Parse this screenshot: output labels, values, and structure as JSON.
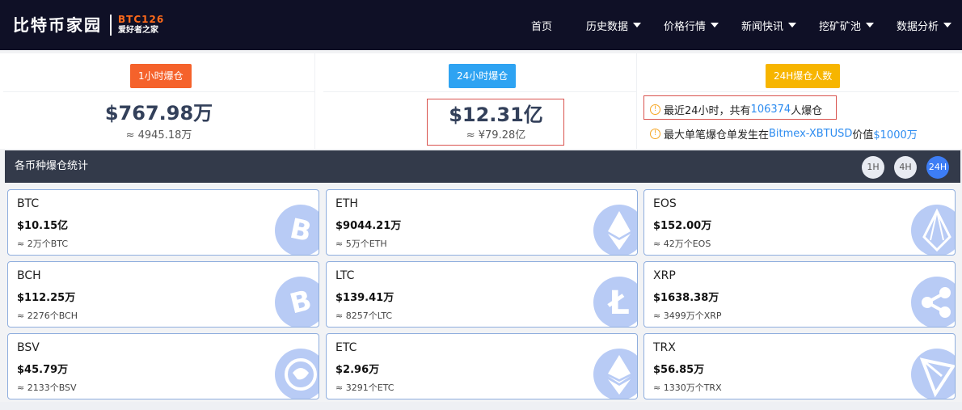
{
  "nav": {
    "logo_cn": "比特币家园",
    "logo_en": "BTC126",
    "logo_sub": "爱好者之家",
    "items": [
      {
        "label": "首页",
        "dropdown": false
      },
      {
        "label": "历史数据",
        "dropdown": true
      },
      {
        "label": "价格行情",
        "dropdown": true
      },
      {
        "label": "新闻快讯",
        "dropdown": true
      },
      {
        "label": "挖矿矿池",
        "dropdown": true
      },
      {
        "label": "数据分析",
        "dropdown": true
      }
    ]
  },
  "stats": {
    "hour1": {
      "tag": "1小时爆仓",
      "tag_color": "#f5622b",
      "value": "$767.98万",
      "approx": "≈ 4945.18万"
    },
    "hour24": {
      "tag": "24小时爆仓",
      "tag_color": "#2ea3f2",
      "value": "$12.31亿",
      "approx": "≈ ¥79.28亿"
    },
    "people": {
      "tag": "24H爆仓人数",
      "tag_color": "#f7b500",
      "line1_prefix": "最近24小时，共有",
      "line1_count": "106374",
      "line1_suffix": "人爆仓",
      "line2_prefix": "最大单笔爆仓单发生在",
      "line2_pair": "Bitmex-XBTUSD",
      "line2_mid": "价值",
      "line2_value": "$1000万"
    }
  },
  "section": {
    "title": "各币种爆仓统计",
    "periods": [
      "1H",
      "4H",
      "24H"
    ],
    "active_period": "24H"
  },
  "coins": [
    {
      "symbol": "BTC",
      "amount": "$10.15亿",
      "qty": "≈ 2万个BTC",
      "icon": "bitcoin-icon"
    },
    {
      "symbol": "ETH",
      "amount": "$9044.21万",
      "qty": "≈ 5万个ETH",
      "icon": "ethereum-icon"
    },
    {
      "symbol": "EOS",
      "amount": "$152.00万",
      "qty": "≈ 42万个EOS",
      "icon": "eos-icon"
    },
    {
      "symbol": "BCH",
      "amount": "$112.25万",
      "qty": "≈ 2276个BCH",
      "icon": "bitcoin-cash-icon"
    },
    {
      "symbol": "LTC",
      "amount": "$139.41万",
      "qty": "≈ 8257个LTC",
      "icon": "litecoin-icon"
    },
    {
      "symbol": "XRP",
      "amount": "$1638.38万",
      "qty": "≈ 3499万个XRP",
      "icon": "ripple-icon"
    },
    {
      "symbol": "BSV",
      "amount": "$45.79万",
      "qty": "≈ 2133个BSV",
      "icon": "bsv-dragon-icon"
    },
    {
      "symbol": "ETC",
      "amount": "$2.96万",
      "qty": "≈ 3291个ETC",
      "icon": "ethereum-classic-icon"
    },
    {
      "symbol": "TRX",
      "amount": "$56.85万",
      "qty": "≈ 1330万个TRX",
      "icon": "tron-icon"
    }
  ]
}
